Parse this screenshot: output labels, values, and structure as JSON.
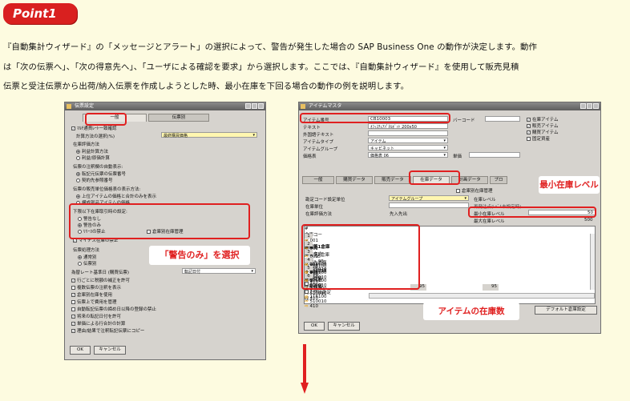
{
  "badge": "Point1",
  "paragraph": [
    "『自動集計ウィザード』の「メッセージとアラート」の選択によって、警告が発生した場合の SAP Business One の動作が決定します。動作",
    "は「次の伝票へ」、「次の得意先へ」、「ユーザによる確認を要求」から選択します。ここでは、『自動集計ウィザード』を使用して販売見積",
    "伝票と受注伝票から出荷/納入伝票を作成しようとした時、最小在庫を下回る場合の動作の例を説明します。"
  ],
  "left_window": {
    "title": "伝票設定",
    "tabs": [
      "一般",
      "伝票別"
    ],
    "lines": {
      "l1": "ﾏﾙﾁ通貨ﾚｰﾄ一致確認",
      "l2": "計算方法の選択(%)",
      "l2_value": "最終購買価格",
      "l3": "在庫評価方法",
      "r1": "利益計算方法",
      "r2": "利益/原価計算",
      "l4": "伝票の注釈欄の自動表示:",
      "r3": "転記元伝票の伝票番号",
      "r4": "契約先参照番号",
      "l5": "伝票の販売単位価格表の表示方法:",
      "r5": "上位アイテムの価格と合計のみを表示",
      "r6": "構成部品アイテムの価格",
      "l6": "下限以下在庫取引時の設定:",
      "r7": "警告なし",
      "r8": "警告のみ",
      "r9": "ﾘﾘｰｽの禁止",
      "c1": "倉庫別在庫管理",
      "c2": "マイナス在庫の禁止",
      "l7": "伝票処理方法",
      "r10": "通常別",
      "r11": "伝票別",
      "l8": "為替レート基準日 (購買伝票)",
      "l8_value": "転記日付",
      "c3": "行ごとに税額の補正を許可",
      "c4": "複数伝票の注釈を表示",
      "c5": "倉庫別在庫を使用",
      "c6": "伝票上で費用を管理",
      "c7": "自動転記伝票の締め日以降の登録の禁止",
      "c8": "将来の転記日付を許可",
      "c9": "単価による行合計の計算",
      "c10": "理由/結果で注釈転記伝票にコピー"
    },
    "ok": "OK",
    "cancel": "キャンセル"
  },
  "left_callout": "「警告のみ」を選択",
  "right_window": {
    "title": "アイテムマスタ",
    "item_code_label": "アイテム番号",
    "item_code_value": "CB10003",
    "barcode_label": "バーコード",
    "name_label": "テキスト",
    "name_value": "ｵﾌｨｽﾁｪｱﾊﾟﾈﾙﾎﾞｯﾄ 200x50",
    "foreign_label": "外国語テキスト",
    "type_label": "アイテムタイプ",
    "type_value": "アイテム",
    "group_label": "アイテムグループ",
    "group_value": "キャビネット",
    "price_label": "価格表",
    "price_value": "価格表 06",
    "unit_price_label": "単価",
    "checks": [
      "在庫アイテム",
      "販売アイテム",
      "購買アイテム",
      "固定資産"
    ],
    "tabs": [
      "一般",
      "購買データ",
      "販売データ",
      "在庫データ",
      "計画データ",
      "プロ"
    ],
    "manage_check": "倉庫別在庫管理",
    "f1_label": "勘定コード設定単位",
    "f1_value": "アイテムグループ",
    "f2_label": "在庫単位",
    "f3_label": "在庫評価方法",
    "f3_value": "先入先出",
    "r1": "在庫レベル",
    "r2": "再発注点(ﾚﾍﾞﾙ未設定時)",
    "r3": "最小在庫レベル",
    "r3_value": "50",
    "r4": "最大在庫レベル",
    "r4_value": "500",
    "grid_headers": [
      "#",
      "倉庫コード",
      "倉庫名",
      "ロック中",
      "在庫",
      "出荷済",
      "オーダ...",
      "利用可能",
      "在庫勘定",
      "売上原価勘定",
      "収..."
    ],
    "rows": [
      {
        "n": "1",
        "code": "001",
        "name": "関東第1倉庫",
        "stock": "95",
        "avail": "95",
        "acct": "116100",
        "cost": "510010",
        "rev": "410"
      },
      {
        "n": "2",
        "code": "002",
        "name": "関東第2倉庫",
        "stock": "",
        "avail": "",
        "acct": "116100",
        "cost": "510010",
        "rev": "410"
      },
      {
        "n": "3",
        "code": "003",
        "name": "技術先倉庫",
        "stock": "",
        "avail": "",
        "acct": "116100",
        "cost": "510010",
        "rev": "410"
      },
      {
        "n": "4",
        "code": "008",
        "name": "未着品倉庫",
        "stock": "",
        "avail": "",
        "acct": "116100",
        "cost": "510010",
        "rev": "410"
      },
      {
        "n": "5",
        "code": "009",
        "name": "返送倉庫",
        "stock": "",
        "avail": "",
        "acct": "116100",
        "cost": "510010",
        "rev": "410"
      },
      {
        "n": "6",
        "code": "01",
        "name": "一般倉庫",
        "stock": "",
        "avail": "",
        "acct": "116100",
        "cost": "510010",
        "rev": "410"
      }
    ],
    "total_stock": "95",
    "total_avail": "95",
    "default_btn": "デフォルト倉庫設定",
    "ok": "OK",
    "cancel": "キャンセル"
  },
  "callout_min": "最小在庫レベル",
  "callout_stock": "アイテムの在庫数",
  "colors": {
    "badge": "#d9201f",
    "highlight": "#e02020",
    "background": "#fdfbe0"
  }
}
